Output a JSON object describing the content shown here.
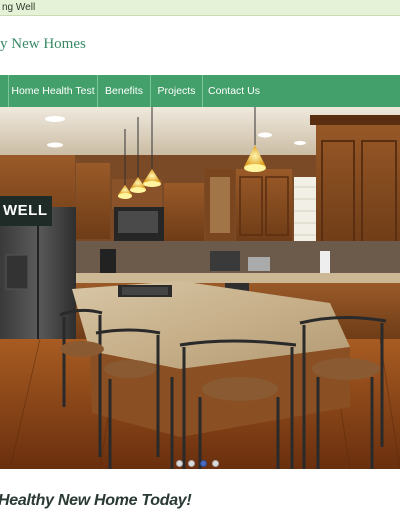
{
  "topbar": {
    "text": "ng Well"
  },
  "brand": {
    "text": "y New Homes",
    "color": "#3a8a66"
  },
  "nav": {
    "color": "#43a06a",
    "items": [
      {
        "label": "Home Health Test"
      },
      {
        "label": "Benefits"
      },
      {
        "label": "Projects"
      },
      {
        "label": "Contact Us"
      }
    ]
  },
  "hero": {
    "image": "kitchen-interior-photo",
    "badge": "WELL",
    "slide_dots": {
      "count": 4,
      "active_index": 2
    }
  },
  "tagline": {
    "text": "Healthy New Home Today!"
  }
}
